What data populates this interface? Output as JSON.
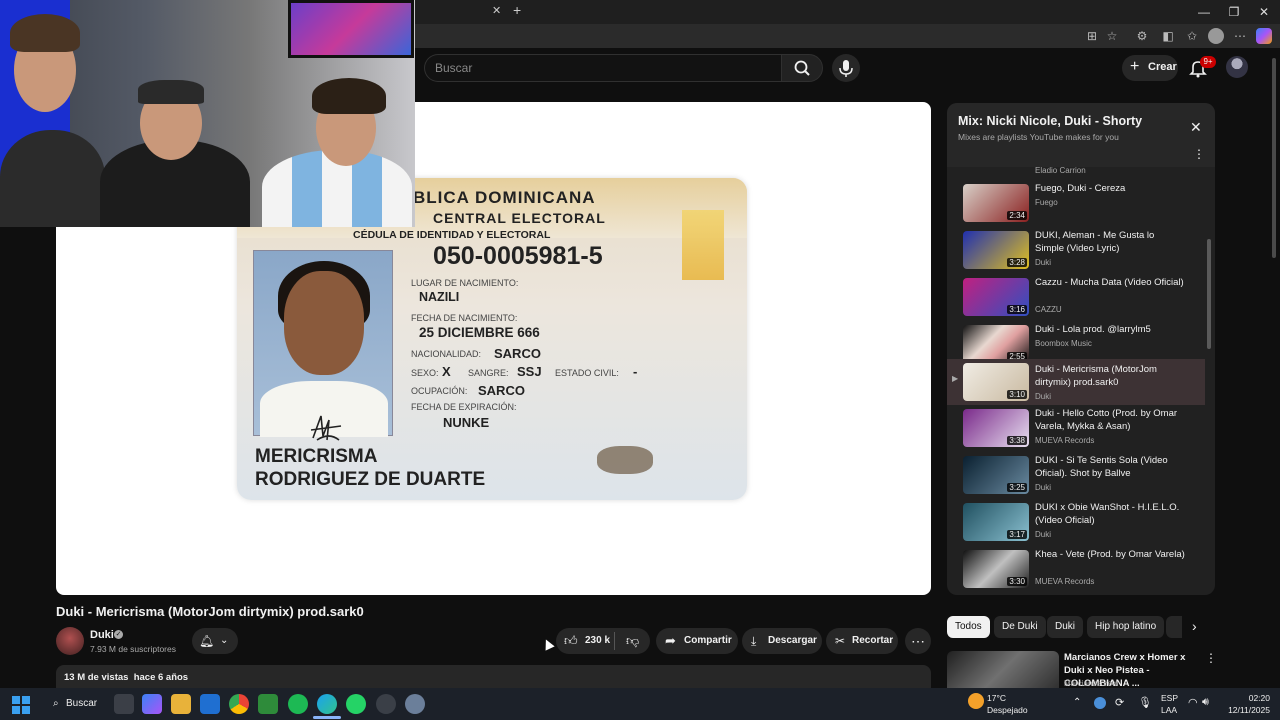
{
  "browser": {
    "close_tab": "✕",
    "new_tab": "+"
  },
  "youtube": {
    "search_placeholder": "Buscar",
    "create_label": "Crear",
    "notifications_badge": "9+"
  },
  "video": {
    "title": "Duki - Mericrisma (MotorJom dirtymix) prod.sark0",
    "channel": "Duki",
    "subscribers": "7.93 M de suscriptores",
    "likes": "230 k",
    "share": "Compartir",
    "download": "Descargar",
    "clip": "Recortar",
    "views_line": "13 M de vistas  hace 6 años"
  },
  "id_card": {
    "country_line": "BLICA DOMINICANA",
    "board_line": "CENTRAL ELECTORAL",
    "doc_type": "CÉDULA DE IDENTIDAD Y ELECTORAL",
    "number": "050-0005981-5",
    "birthplace_label": "LUGAR DE NACIMIENTO:",
    "birthplace": "NAZILI",
    "birthdate_label": "FECHA DE NACIMIENTO:",
    "birthdate": "25 DICIEMBRE 666",
    "nationality_label": "NACIONALIDAD:",
    "nationality": "SARCO",
    "sex_label": "SEXO:",
    "sex": "X",
    "blood_label": "SANGRE:",
    "blood": "SSJ",
    "civil_label": "ESTADO CIVIL:",
    "civil": "-",
    "occupation_label": "OCUPACIÓN:",
    "occupation": "SARCO",
    "expiry_label": "FECHA DE EXPIRACIÓN:",
    "expiry": "NUNKE",
    "name_line1": "MERICRISMA",
    "name_line2": "RODRIGUEZ DE DUARTE"
  },
  "playlist": {
    "title": "Mix: Nicki Nicole, Duki - Shorty",
    "subtitle": "Mixes are playlists YouTube makes for you",
    "top_partial_channel": "Eladio Carrion",
    "items": [
      {
        "title": "Fuego, Duki - Cereza",
        "channel": "Fuego",
        "duration": "2:34"
      },
      {
        "title": "DUKI, Aleman - Me Gusta lo Simple (Video Lyric)",
        "channel": "Duki",
        "duration": "3:28"
      },
      {
        "title": "Cazzu - Mucha Data (Video Oficial)",
        "channel": "CAZZU",
        "duration": "3:16"
      },
      {
        "title": "Duki - Lola prod. @larrylm5",
        "channel": "Boombox Music",
        "duration": "2:55"
      },
      {
        "title": "Duki - Mericrisma (MotorJom dirtymix) prod.sark0",
        "channel": "Duki",
        "duration": "3:10"
      },
      {
        "title": "Duki - Hello Cotto (Prod. by Omar Varela, Mykka & Asan)",
        "channel": "MUEVA Records",
        "duration": "3:38"
      },
      {
        "title": "DUKI - Si Te Sentis Sola (Video Oficial). Shot by Ballve",
        "channel": "Duki",
        "duration": "3:25"
      },
      {
        "title": "DUKI x Obie WanShot - H.I.E.L.O. (Video Oficial)",
        "channel": "Duki",
        "duration": "3:17"
      },
      {
        "title": "Khea - Vete (Prod. by Omar Varela)",
        "channel": "MUEVA Records",
        "duration": "3:30"
      }
    ]
  },
  "chips": [
    "Todos",
    "De Duki",
    "Duki",
    "Hip hop latino"
  ],
  "recommendation": {
    "title": "Marcianos Crew x Homer x Duki x Neo Pistea - COLOMBIANA ...",
    "channel": "Marcianoscrew"
  },
  "taskbar": {
    "search": "Buscar",
    "temperature": "17°C",
    "weather": "Despejado",
    "lang": "ESP",
    "layout": "LAA",
    "time": "02:20",
    "date": "12/11/2025"
  }
}
